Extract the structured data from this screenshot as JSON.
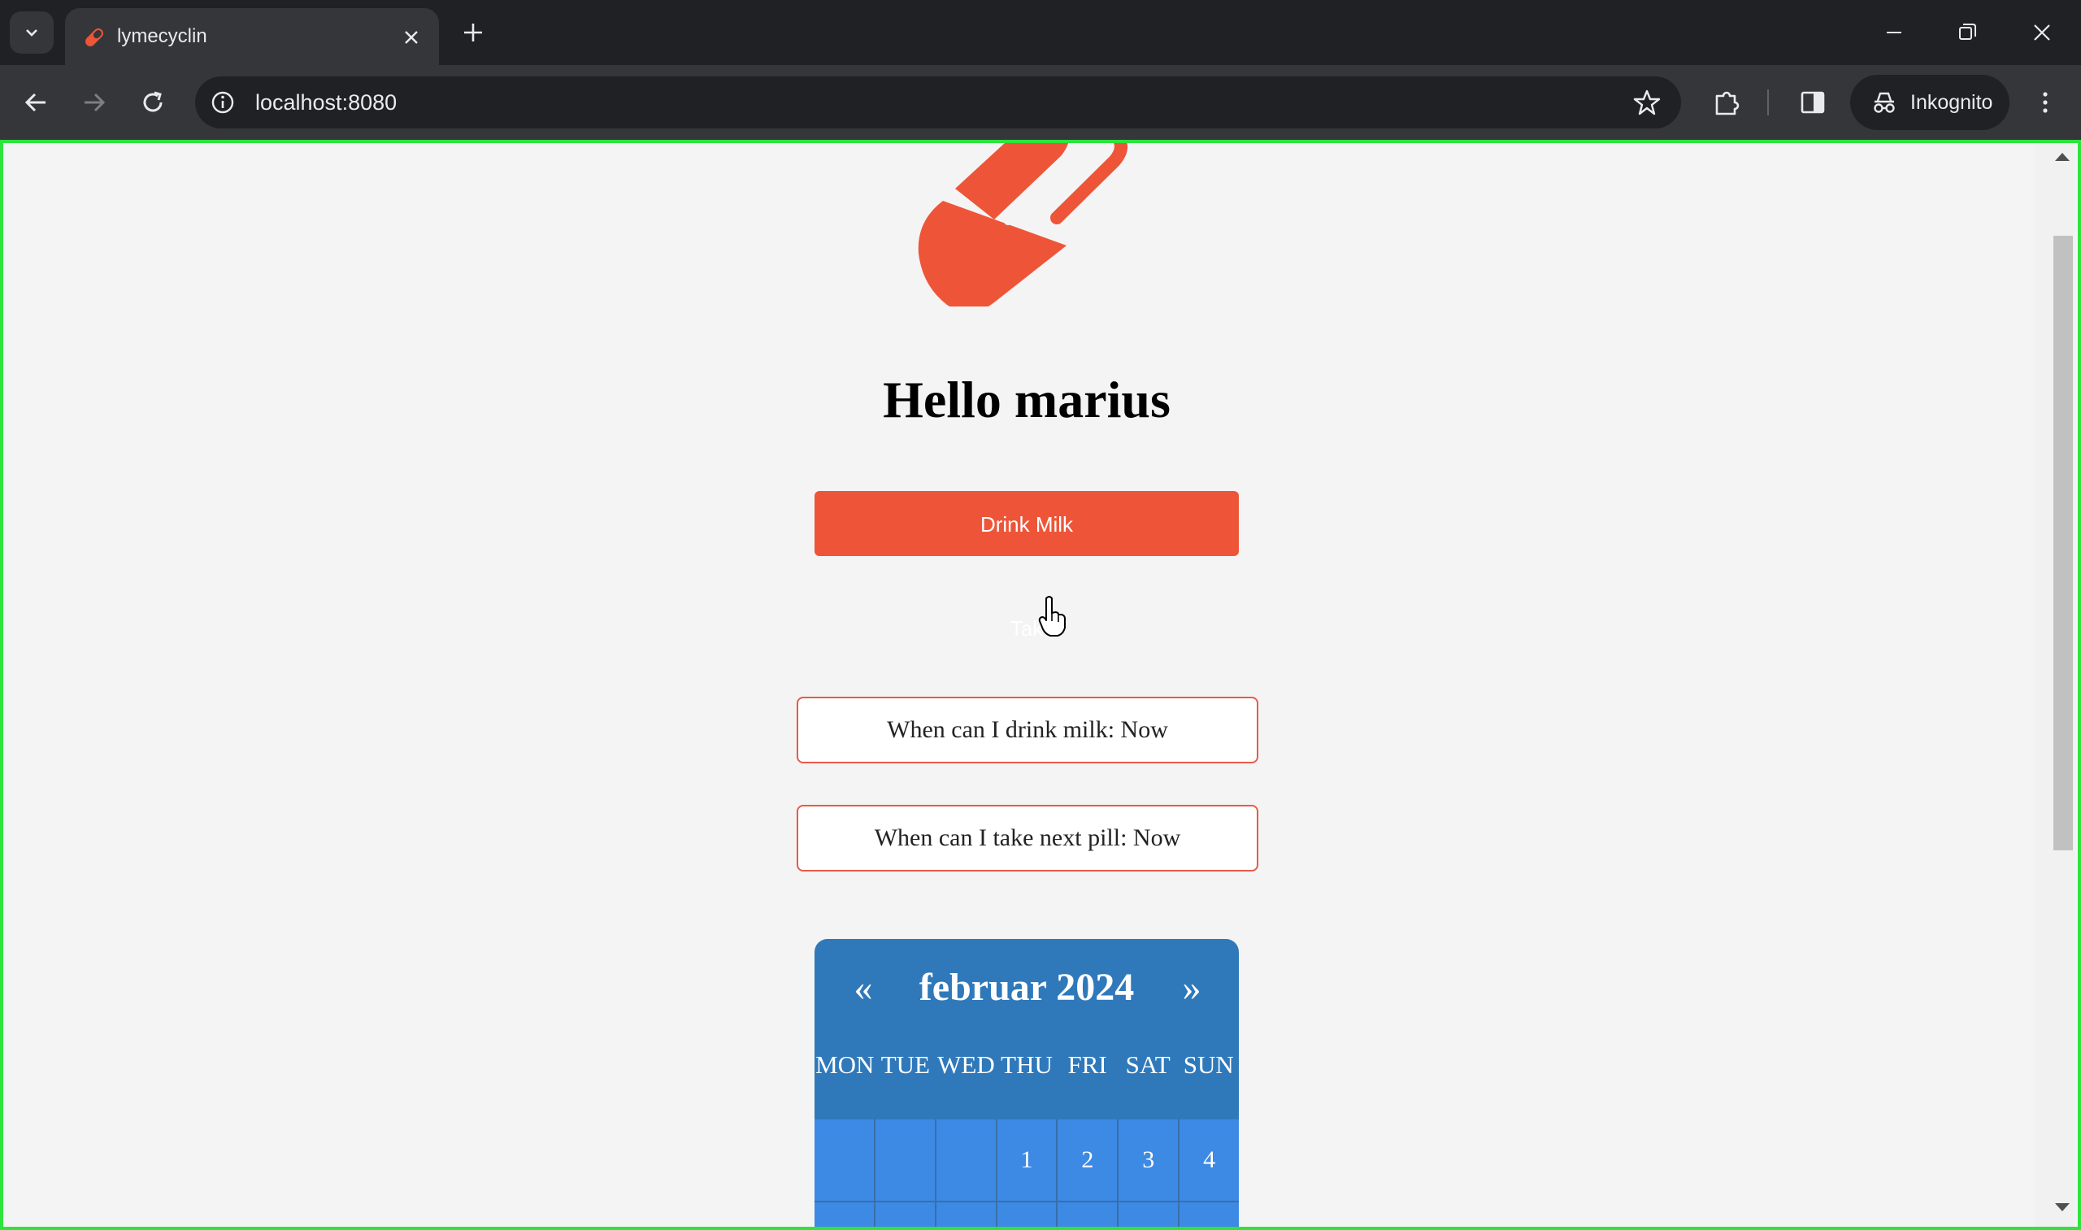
{
  "browser": {
    "tab_title": "lymecyclin",
    "url": "localhost:8080",
    "incognito_label": "Inkognito"
  },
  "page": {
    "greeting": "Hello marius",
    "drink_button_label": "Drink Milk",
    "take_button_label": "Tak",
    "milk_status": "When can I drink milk: Now",
    "pill_status": "When can I take next pill: Now"
  },
  "calendar": {
    "prev_label": "«",
    "next_label": "»",
    "month_label": "februar 2024",
    "weekdays": [
      "MON",
      "TUE",
      "WED",
      "THU",
      "FRI",
      "SAT",
      "SUN"
    ],
    "first_row": [
      "",
      "",
      "",
      "1",
      "2",
      "3",
      "4"
    ]
  },
  "colors": {
    "accent": "#ee5538",
    "calendar_header": "#2f79bb",
    "calendar_cell": "#3d8ae5",
    "focus_outline": "#2ee33c"
  }
}
